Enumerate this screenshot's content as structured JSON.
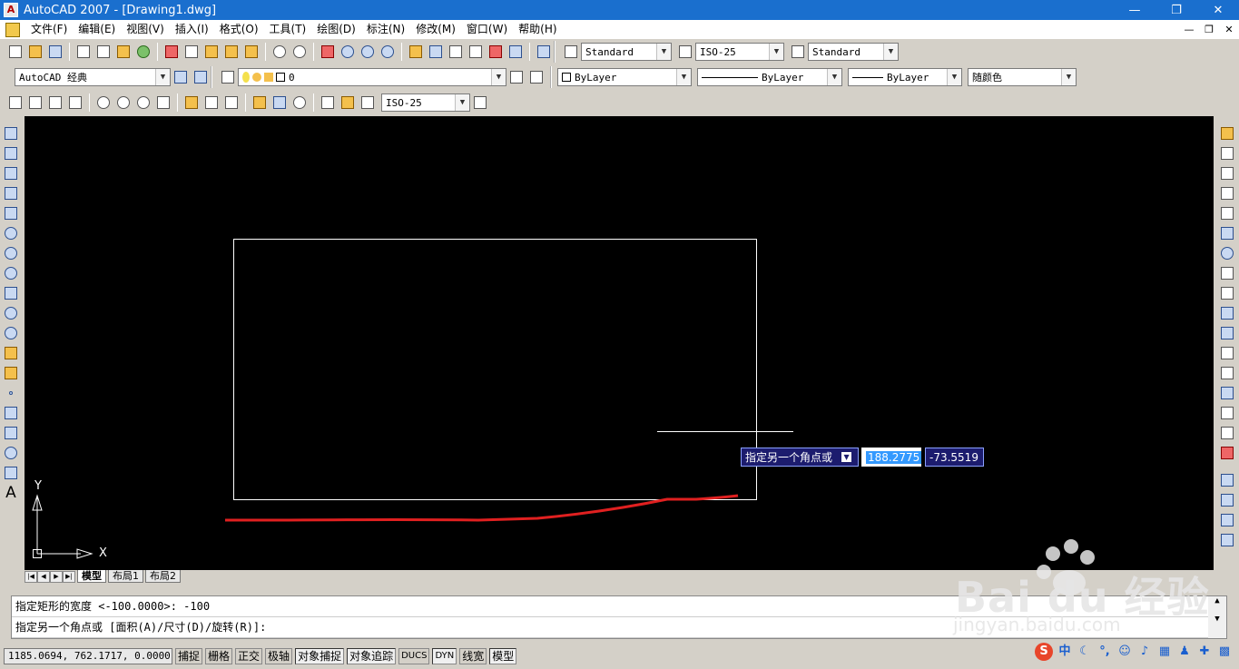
{
  "window": {
    "title": "AutoCAD 2007 - [Drawing1.dwg]",
    "controls": [
      "—",
      "❐",
      "✕"
    ],
    "doc_controls": [
      "—",
      "❐",
      "✕"
    ]
  },
  "menu": [
    "文件(F)",
    "编辑(E)",
    "视图(V)",
    "插入(I)",
    "格式(O)",
    "工具(T)",
    "绘图(D)",
    "标注(N)",
    "修改(M)",
    "窗口(W)",
    "帮助(H)"
  ],
  "toolbar1": {
    "text_style": "Standard",
    "dim_style": "ISO-25",
    "table_style": "Standard"
  },
  "toolbar2": {
    "workspace": "AutoCAD 经典",
    "layer": "0",
    "color": "ByLayer",
    "linetype": "ByLayer",
    "lineweight": "ByLayer",
    "plot_style": "随颜色"
  },
  "toolbar3": {
    "dim_style": "ISO-25"
  },
  "canvas": {
    "ucs_x": "X",
    "ucs_y": "Y",
    "colors": {
      "background": "#000000",
      "geometry": "#ffffff",
      "annotation": "#e02020"
    }
  },
  "dynamic_input": {
    "prompt": "指定另一个角点或",
    "value_x": "188.2775",
    "value_y": "-73.5519"
  },
  "layout_tabs": [
    "模型",
    "布局1",
    "布局2"
  ],
  "command_history": [
    "指定矩形的宽度 <-100.0000>: -100",
    "指定另一个角点或 [面积(A)/尺寸(D)/旋转(R)]:"
  ],
  "status": {
    "coords": "1185.0694, 762.1717, 0.0000",
    "buttons": [
      "捕捉",
      "栅格",
      "正交",
      "极轴",
      "对象捕捉",
      "对象追踪",
      "DUCS",
      "DYN",
      "线宽",
      "模型"
    ]
  },
  "tray": {
    "ime": "中",
    "logo": "S"
  },
  "watermark": {
    "brand": "Bai du 经验",
    "url": "jingyan.baidu.com"
  }
}
